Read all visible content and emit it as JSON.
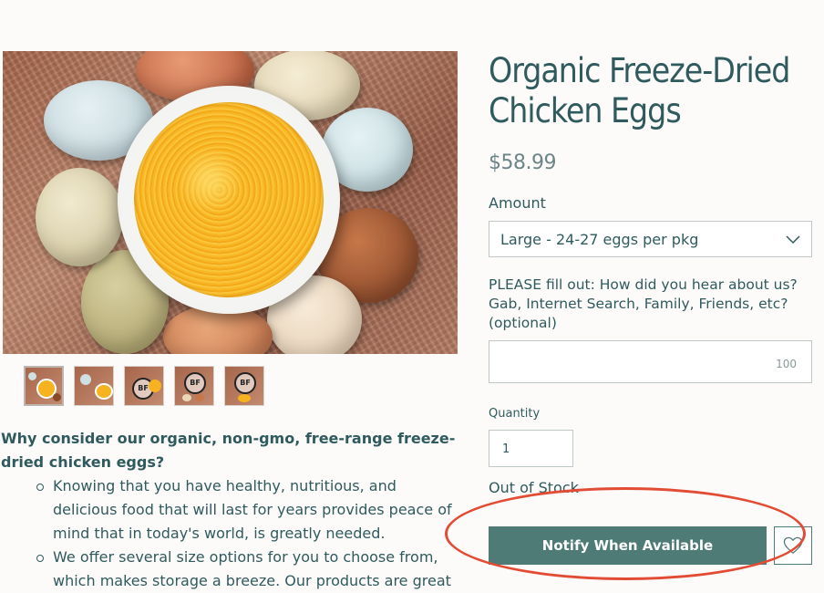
{
  "product": {
    "title": "Organic Freeze-Dried Chicken Eggs",
    "price": "$58.99",
    "amount_label": "Amount",
    "amount_selected": "Large - 24-27 eggs per pkg",
    "question_label": "PLEASE fill out: How did you hear about us? Gab, Internet Search, Family, Friends, etc? (optional)",
    "char_limit": "100",
    "quantity_label": "Quantity",
    "quantity_value": "1",
    "stock_status": "Out of Stock",
    "notify_label": "Notify When Available"
  },
  "gallery": {
    "thumbnail_count": 5
  },
  "description": {
    "heading": "Why consider our organic, non-gmo, free-range freeze-dried chicken eggs?",
    "bullets": [
      "Knowing that you have healthy, nutritious, and delicious food that will last for years provides peace of mind that in today's world, is greatly needed.",
      "We offer several size options for you to choose from, which makes storage a breeze. Our products are great"
    ]
  },
  "colors": {
    "accent": "#4f7b77",
    "text": "#2f5a5e",
    "annotation": "#e24b34"
  },
  "icons": {
    "select": "chevron-down-icon",
    "wishlist": "heart-icon"
  }
}
